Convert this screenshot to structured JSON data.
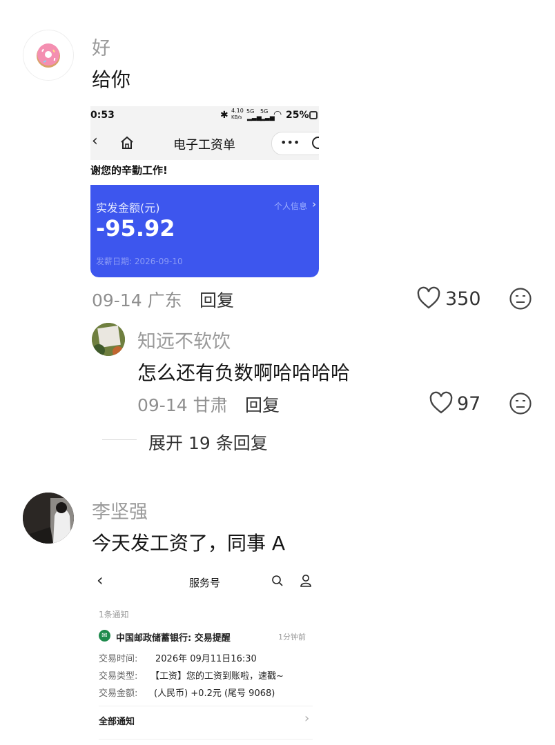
{
  "comment1": {
    "username": "好",
    "text": "给你",
    "meta": "09-14 广东",
    "reply_label": "回复",
    "likes": "350",
    "screenshot": {
      "time": "0:53",
      "speed": "4.10",
      "speed_unit": "KB/s",
      "net1": "5G",
      "net2": "5G",
      "battery": "25%",
      "title": "电子工资单",
      "more": "•••",
      "thanks": "谢您的辛勤工作!",
      "amount_label": "实发金额(元)",
      "personal_info": "个人信息",
      "amount": "-95.92",
      "pay_date": "发薪日期: 2026-09-10"
    }
  },
  "reply1": {
    "username": "知远不软饮",
    "text": "怎么还有负数啊哈哈哈哈",
    "meta": "09-14 甘肃",
    "reply_label": "回复",
    "likes": "97"
  },
  "expand_replies": "展开 19 条回复",
  "comment2": {
    "username": "李坚强",
    "text": "今天发工资了，同事 A",
    "screenshot": {
      "title": "服务号",
      "count": "1条通知",
      "bank": "中国邮政储蓄银行: 交易提醒",
      "time_ago": "1分钟前",
      "rows": [
        {
          "label": "交易时间:",
          "value": "2026年 09月11日16:30"
        },
        {
          "label": "交易类型:",
          "value": "【工资】您的工资到账啦，速戳~"
        },
        {
          "label": "交易金额:",
          "value": "(人民币) +0.2元 (尾号 9068)"
        }
      ],
      "all": "全部通知"
    }
  },
  "colors": {
    "card_blue": "#3d56ee",
    "meta_gray": "#8f8f8f"
  }
}
